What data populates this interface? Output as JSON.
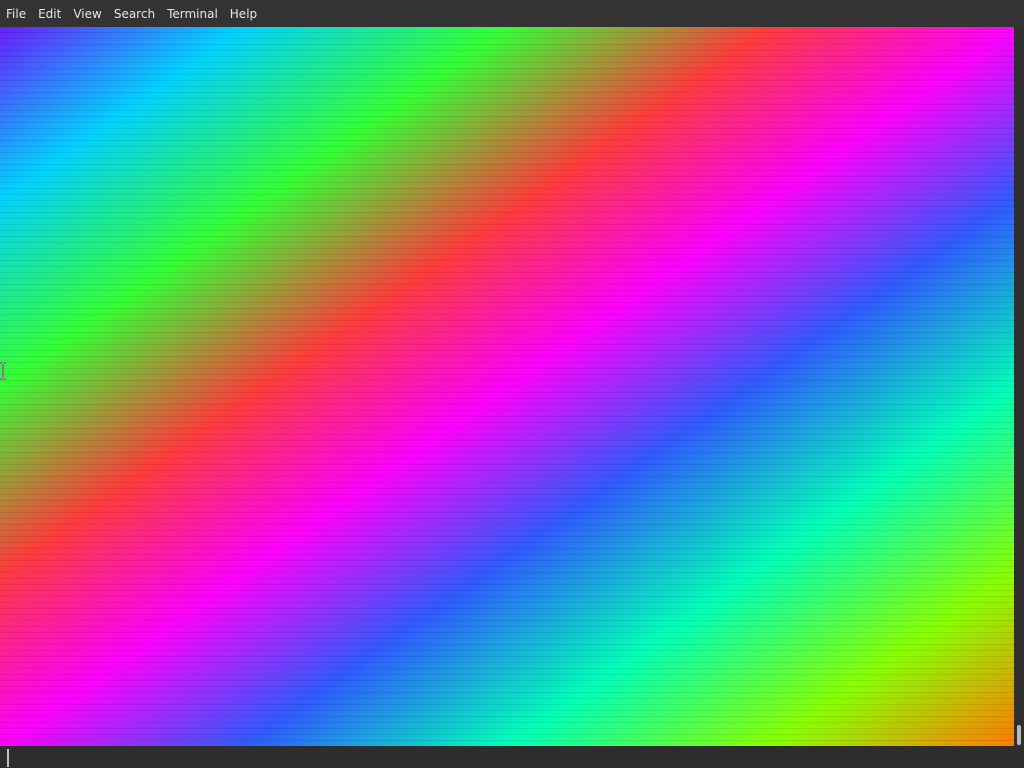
{
  "menubar": {
    "items": [
      {
        "label": "File"
      },
      {
        "label": "Edit"
      },
      {
        "label": "View"
      },
      {
        "label": "Search"
      },
      {
        "label": "Terminal"
      },
      {
        "label": "Help"
      }
    ]
  },
  "terminal": {
    "background_colors": [
      "#6b1cff",
      "#00d2ff",
      "#33ff33",
      "#ff3b3b",
      "#ff00ff",
      "#2f5bff"
    ]
  },
  "icons": {
    "cursor": "text-cursor-ibeam"
  }
}
